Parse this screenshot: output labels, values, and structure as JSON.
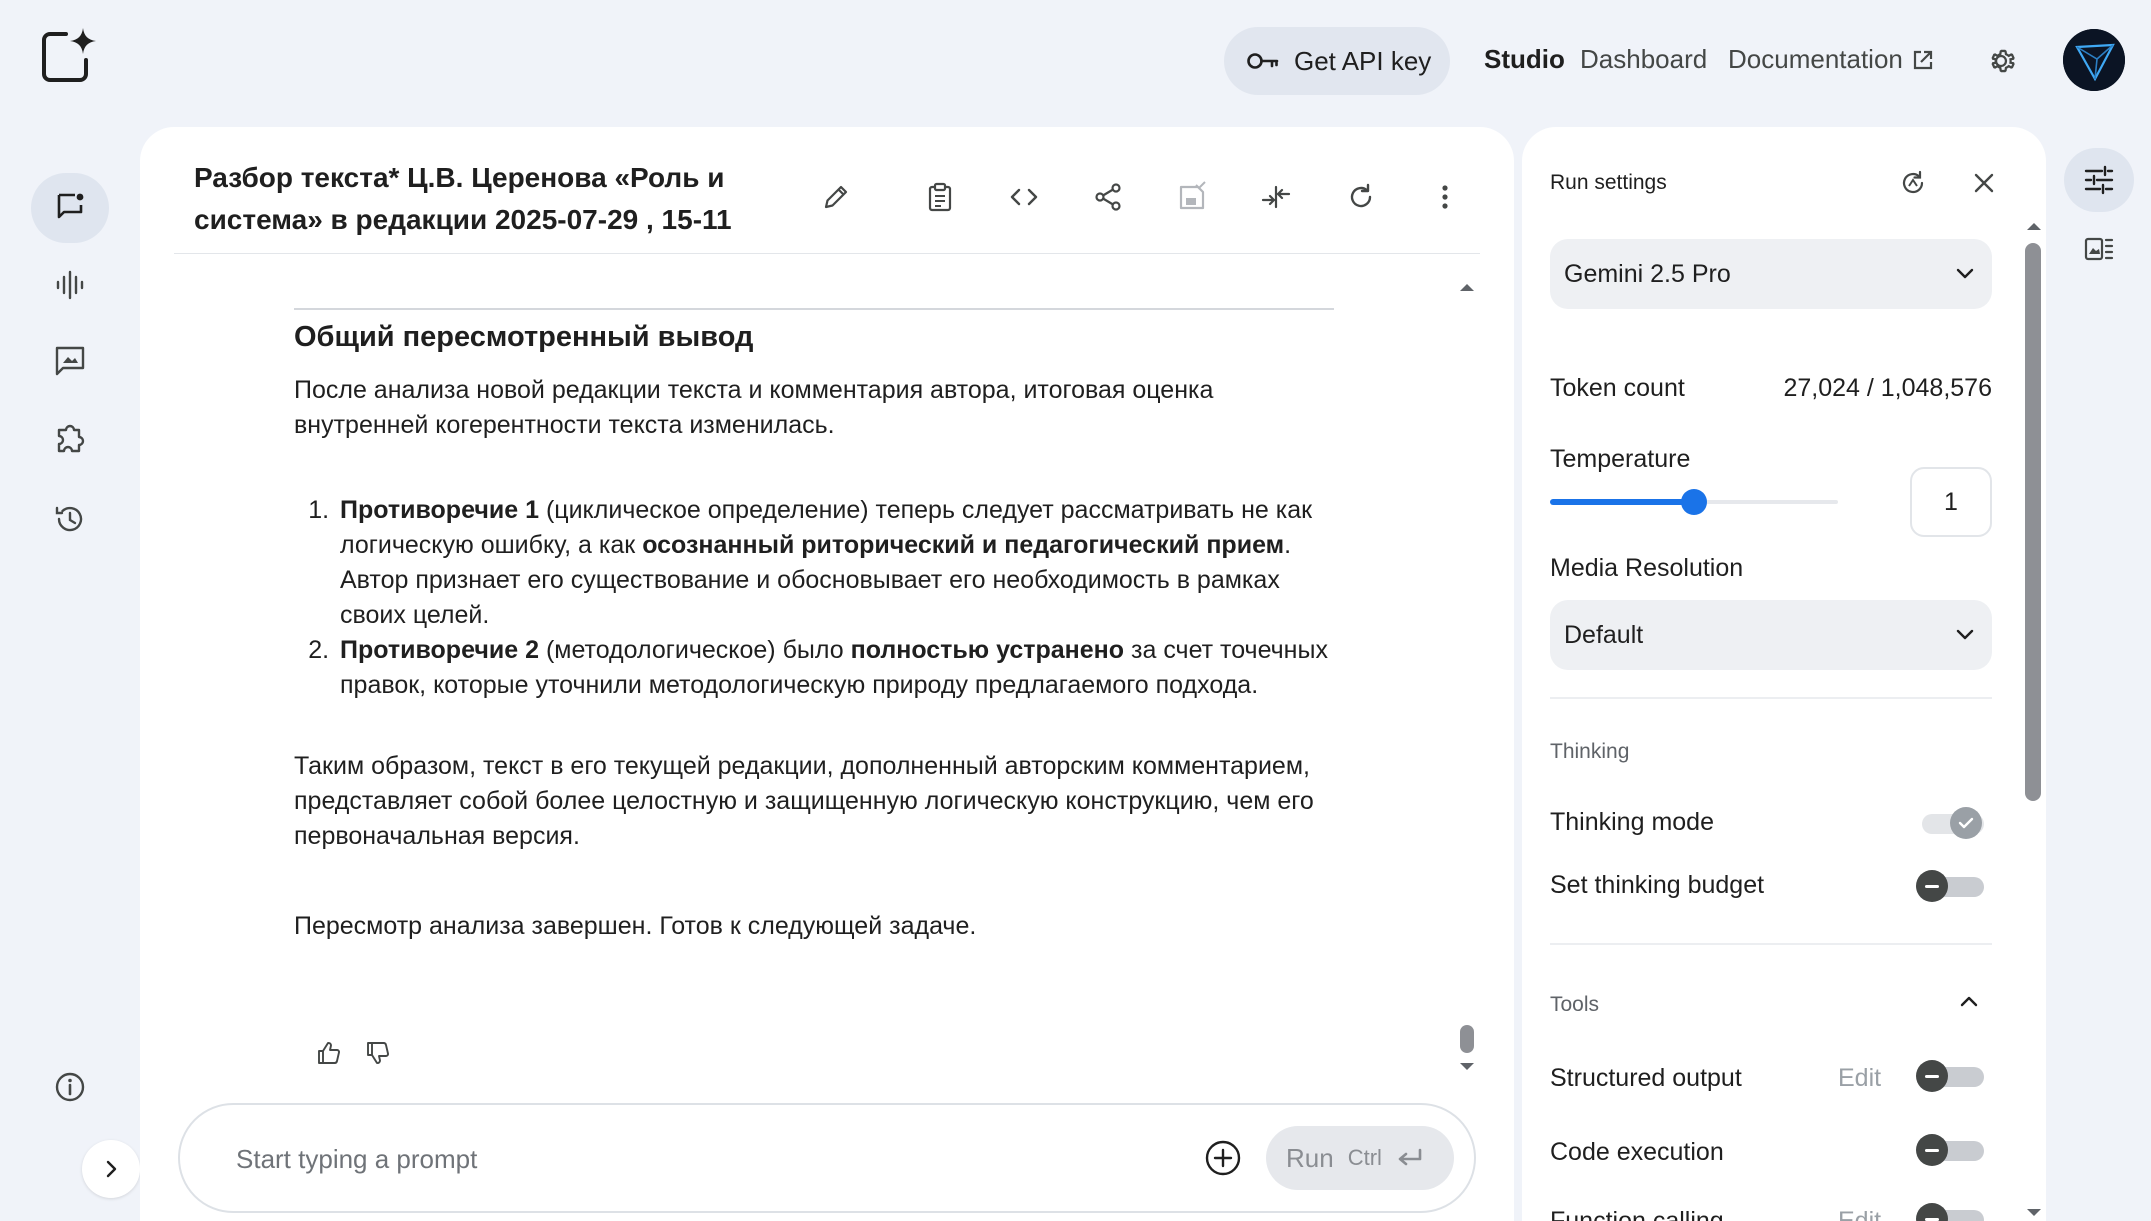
{
  "topbar": {
    "api_key_label": "Get API key",
    "nav": [
      {
        "label": "Studio",
        "active": true
      },
      {
        "label": "Dashboard",
        "active": false
      },
      {
        "label": "Documentation",
        "active": false
      }
    ]
  },
  "left_rail": {
    "items": [
      {
        "name": "chat-icon",
        "active": true
      },
      {
        "name": "stream-audio-icon",
        "active": false
      },
      {
        "name": "media-gen-icon",
        "active": false
      },
      {
        "name": "build-puzzle-icon",
        "active": false
      },
      {
        "name": "history-icon",
        "active": false
      }
    ],
    "info_icon": "info-icon",
    "expand_icon": "chevron-right-icon"
  },
  "chat": {
    "title_line1": "Разбор текста* Ц.В. Церенова «Роль и",
    "title_line2": "система» в редакции 2025-07-29 , 15-11",
    "toolbar_icons": [
      "edit-pencil-icon",
      "clipboard-icon",
      "code-icon",
      "share-icon",
      "save-icon",
      "compare-icon",
      "refresh-icon",
      "more-vert-icon"
    ],
    "heading": "Общий пересмотренный вывод",
    "intro": "После анализа новой редакции текста и комментария автора, итоговая оценка внутренней когерентности текста изменилась.",
    "list": [
      {
        "bold1": "Противоречие 1",
        "text1": " (циклическое определение) теперь следует рассматривать не как логическую ошибку, а как ",
        "bold2": "осознанный риторический и педагогический прием",
        "text2": ". Автор признает его существование и обосновывает его необходимость в рамках своих целей."
      },
      {
        "bold1": "Противоречие 2",
        "text1": " (методологическое) было ",
        "bold2": "полностью устранено",
        "text2": " за счет точечных правок, которые уточнили методологическую природу предлагаемого подхода."
      }
    ],
    "conclusion": "Таким образом, текст в его текущей редакции, дополненный авторским комментарием, представляет собой более целостную и защищенную логическую конструкцию, чем его первоначальная версия.",
    "final": "Пересмотр анализа завершен. Готов к следующей задаче."
  },
  "prompt": {
    "placeholder": "Start typing a prompt",
    "run_label": "Run",
    "run_shortcut": "Ctrl"
  },
  "settings": {
    "title": "Run settings",
    "model": "Gemini 2.5 Pro",
    "token_count_label": "Token count",
    "token_count_value": "27,024 / 1,048,576",
    "temperature_label": "Temperature",
    "temperature_value": "1",
    "temperature_fraction": 0.5,
    "media_resolution_label": "Media Resolution",
    "media_resolution_value": "Default",
    "thinking_section": "Thinking",
    "thinking_mode_label": "Thinking mode",
    "thinking_budget_label": "Set thinking budget",
    "tools_section": "Tools",
    "structured_output_label": "Structured output",
    "edit_label": "Edit",
    "code_execution_label": "Code execution",
    "function_calling_label": "Function calling"
  }
}
